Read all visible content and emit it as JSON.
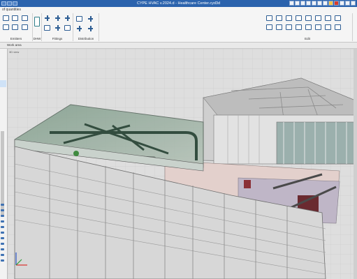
{
  "window": {
    "title": "CYPE HVAC v.2024.d - Healthcare Center.cyd3d"
  },
  "ribbon": {
    "tab_label": "of quantities",
    "groups": [
      {
        "label": "Emitters"
      },
      {
        "label": "DHW"
      },
      {
        "label": "Fittings"
      },
      {
        "label": "Distribution"
      },
      {
        "label": "Edit"
      }
    ]
  },
  "workspace": {
    "tab_label": "Work area",
    "viewport_label": "3D view"
  },
  "colors": {
    "titlebar": "#2b63ad",
    "ribbon_bg": "#f5f5f5",
    "accent_red": "#d93b2b",
    "grid_bg": "#dddddd",
    "glass_roof": "#8aa393"
  }
}
